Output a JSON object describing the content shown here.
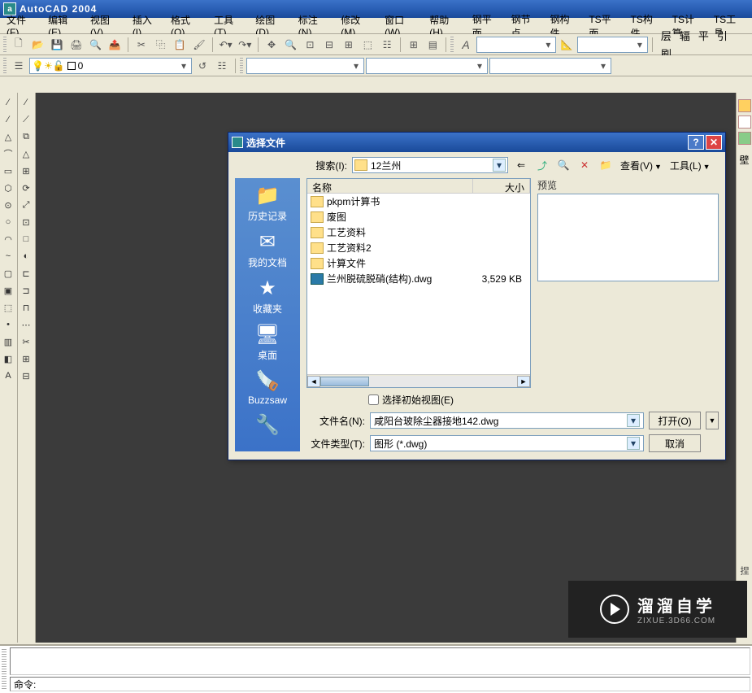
{
  "app": {
    "title": "AutoCAD 2004",
    "icon_letter": "a"
  },
  "menu": [
    "文件(F)",
    "编辑(E)",
    "视图(V)",
    "插入(I)",
    "格式(O)",
    "工具(T)",
    "绘图(D)",
    "标注(N)",
    "修改(M)",
    "窗口(W)",
    "帮助(H)",
    "钢平面",
    "钢节点",
    "钢构件",
    "TS平面",
    "TS构件",
    "TS计算",
    "TS工具"
  ],
  "toolbar2_right": [
    "层",
    "辐",
    "平",
    "引",
    "刷"
  ],
  "layer_combo": {
    "value": "0"
  },
  "dialog": {
    "title": "选择文件",
    "search_label": "搜索(I):",
    "folder": "12兰州",
    "view_label": "查看(V)",
    "tools_label": "工具(L)",
    "preview_label": "预览",
    "places": [
      {
        "name": "history",
        "label": "历史记录",
        "icon": "📁"
      },
      {
        "name": "mydocs",
        "label": "我的文档",
        "icon": "✉"
      },
      {
        "name": "favorites",
        "label": "收藏夹",
        "icon": "★"
      },
      {
        "name": "desktop",
        "label": "桌面",
        "icon": "🖥"
      },
      {
        "name": "buzzsaw",
        "label": "Buzzsaw",
        "icon": "🪚"
      },
      {
        "name": "ftp",
        "label": "",
        "icon": "🔧"
      }
    ],
    "columns": {
      "name": "名称",
      "size": "大小"
    },
    "files": [
      {
        "type": "folder",
        "name": "pkpm计算书",
        "size": ""
      },
      {
        "type": "folder",
        "name": "废图",
        "size": ""
      },
      {
        "type": "folder",
        "name": "工艺资料",
        "size": ""
      },
      {
        "type": "folder",
        "name": "工艺资料2",
        "size": ""
      },
      {
        "type": "folder",
        "name": "计算文件",
        "size": ""
      },
      {
        "type": "dwg",
        "name": "兰州脱硫脱硝(结构).dwg",
        "size": "3,529 KB"
      }
    ],
    "checkbox_label": "选择初始视图(E)",
    "filename_label": "文件名(N):",
    "filename_value": "咸阳台玻除尘器接地142.dwg",
    "filetype_label": "文件类型(T):",
    "filetype_value": "图形 (*.dwg)",
    "open_btn": "打开(O)",
    "cancel_btn": "取消"
  },
  "watermark": {
    "brand": "溜溜自学",
    "url": "ZIXUE.3D66.COM"
  },
  "command": {
    "prompt": "命令:"
  },
  "right_label": "捏"
}
